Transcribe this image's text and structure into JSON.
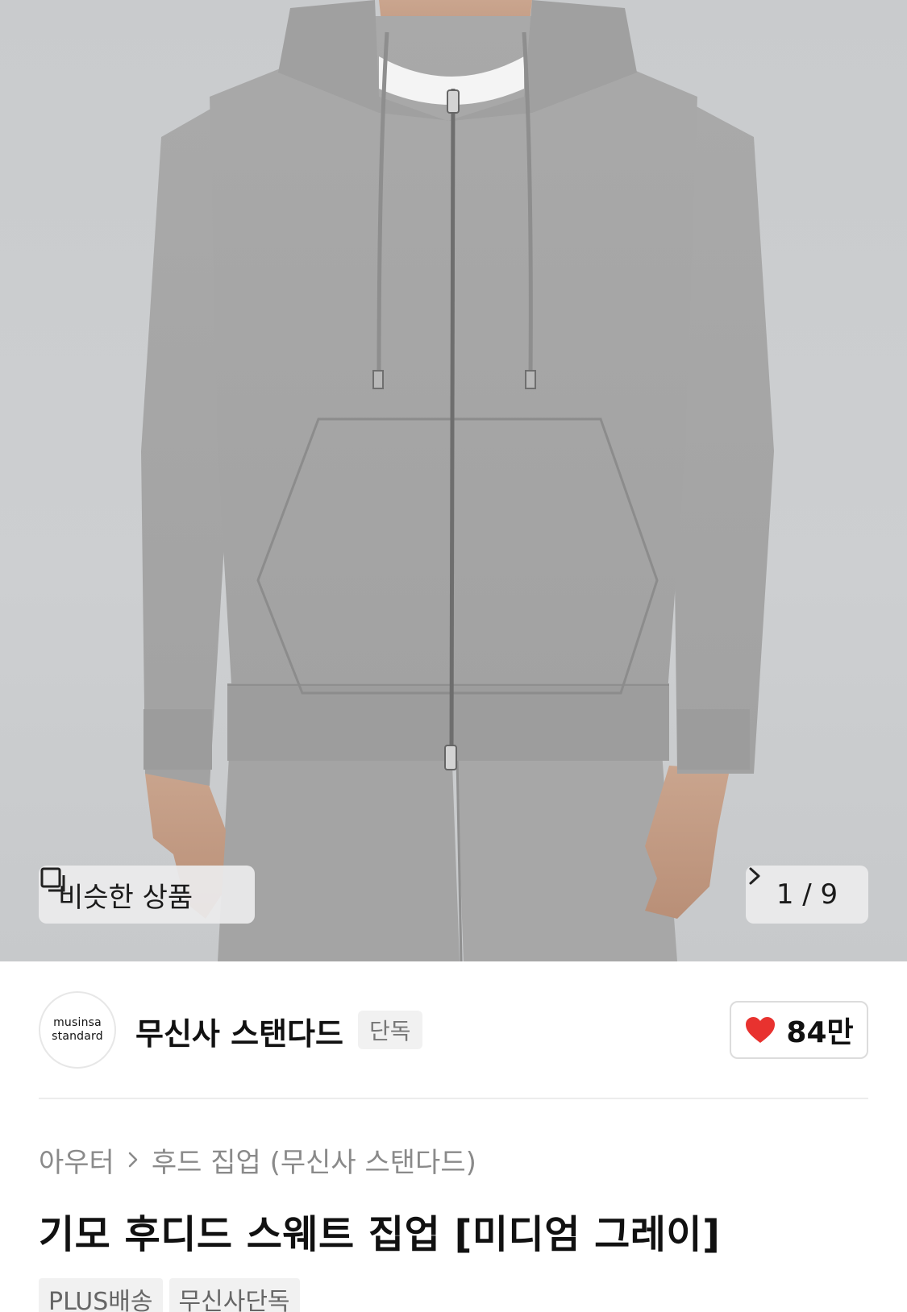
{
  "gallery": {
    "similar_label": "비슷한 상품",
    "counter_current": "1",
    "counter_sep": "/",
    "counter_total": "9"
  },
  "brand": {
    "logo_line1": "musinsa",
    "logo_line2": "standard",
    "name": "무신사 스탠다드",
    "badge": "단독"
  },
  "like": {
    "count": "84만",
    "heart_color": "#e8322f"
  },
  "breadcrumb": {
    "category": "아우터",
    "subcategory": "후드 집업 (무신사 스탠다드)"
  },
  "product": {
    "title": "기모 후디드 스웨트 집업 [미디엄 그레이]"
  },
  "tags": [
    "PLUS배송",
    "무신사단독"
  ]
}
